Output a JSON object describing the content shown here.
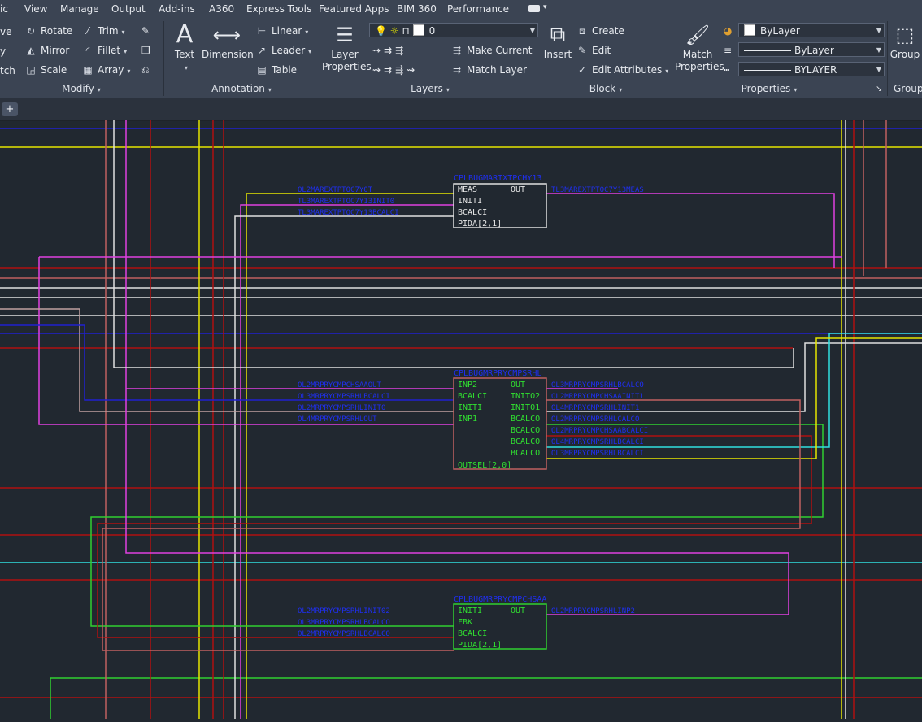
{
  "menu_tabs": [
    "ic",
    "View",
    "Manage",
    "Output",
    "Add-ins",
    "A360",
    "Express Tools",
    "Featured Apps",
    "BIM 360",
    "Performance"
  ],
  "ribbon": {
    "partial_left": [
      "ve",
      "y",
      "tch"
    ],
    "modify": {
      "title": "Modify",
      "items": [
        {
          "label": "Rotate",
          "icon": "rotate-icon"
        },
        {
          "label": "Trim",
          "icon": "trim-icon"
        },
        {
          "label": "Mirror",
          "icon": "mirror-icon"
        },
        {
          "label": "Fillet",
          "icon": "fillet-icon"
        },
        {
          "label": "Scale",
          "icon": "scale-icon"
        },
        {
          "label": "Array",
          "icon": "array-icon"
        }
      ]
    },
    "annotation": {
      "title": "Annotation",
      "text_label": "Text",
      "dimension_label": "Dimension",
      "linear_label": "Linear",
      "leader_label": "Leader",
      "table_label": "Table"
    },
    "layers": {
      "title": "Layers",
      "layer_properties_line1": "Layer",
      "layer_properties_line2": "Properties",
      "layer_combo_value": "0",
      "make_current_label": "Make Current",
      "match_layer_label": "Match Layer"
    },
    "block": {
      "title": "Block",
      "insert_label": "Insert",
      "create_label": "Create",
      "edit_label": "Edit",
      "edit_attributes_label": "Edit Attributes"
    },
    "properties": {
      "title": "Properties",
      "match_line1": "Match",
      "match_line2": "Properties",
      "color_value": "ByLayer",
      "lineweight_value": "ByLayer",
      "linetype_value": "BYLAYER"
    },
    "groups": {
      "title": "Groups",
      "group_label": "Group"
    }
  },
  "colors": {
    "canvas_bg": "#212830",
    "ribbon_bg": "#3b4453",
    "block_label": "#1f2ff0",
    "pin_text": "#e8e8e8",
    "yellow": "#e6e600",
    "magenta": "#e040e0",
    "red": "#b01010",
    "white": "#e0e0e0",
    "cyan": "#30e0e0",
    "green": "#30d030",
    "blue": "#2020d0",
    "salmon": "#c06060"
  },
  "blocks": [
    {
      "title": "CPLBUGMARIXTPCHY13",
      "pins_left": [
        "MEAS",
        "INITI",
        "BCALCI",
        "PIDA[2,1]"
      ],
      "pins_right": [
        "OUT"
      ],
      "inputs": [
        "OL2MAREXTPTOC7Y0T",
        "TL3MAREXTPTOC7Y13INIT0",
        "TL3MAREXTPTOC7Y13BCALCI"
      ],
      "outputs": [
        "TL3MAREXTPTOC7Y13MEAS"
      ]
    },
    {
      "title": "CPLBUGMRPRYCMPSRHL",
      "pins_left": [
        "INP2",
        "BCALCI",
        "INITI",
        "INP1",
        "OUTSEL[2,0]"
      ],
      "pins_right": [
        "OUT",
        "INITO2",
        "INITO1",
        "BCALCO",
        "BCALCO",
        "BCALCO",
        "BCALCO"
      ],
      "inputs": [
        "OL2MRPRYCMPCHSAAOUT",
        "OL3MRPRYCMPSRHLBCALCI",
        "OL2MRPRYCMPSRHLINIT0",
        "OL4MRPRYCMPSRHLOUT"
      ],
      "outputs": [
        "OL3MRPRYCMPSRHLBCALCO",
        "OL2MRPRYCMPCHSAAINIT1",
        "OL4MRPRYCMPSRHLINIT1",
        "OL2MRPRYCMPSRHLCALCO",
        "OL2MRPRYCMPCHSAABCALCI",
        "OL4MRPRYCMPSRHLBCALCI",
        "OL3MRPRYCMPSRHLBCALCI"
      ]
    },
    {
      "title": "CPLBUGMRPRYCMPCHSAA",
      "pins_left": [
        "INITI",
        "FBK",
        "BCALCI",
        "PIDA[2,1]"
      ],
      "pins_right": [
        "OUT"
      ],
      "inputs": [
        "OL2MRPRYCMPSRHLINIT02",
        "OL3MRPRYCMPSRHLBCALCO",
        "OL2MRPRYCMPSRHLBCALCO"
      ],
      "outputs": [
        "OL2MRPRYCMPSRHLINP2"
      ]
    }
  ]
}
